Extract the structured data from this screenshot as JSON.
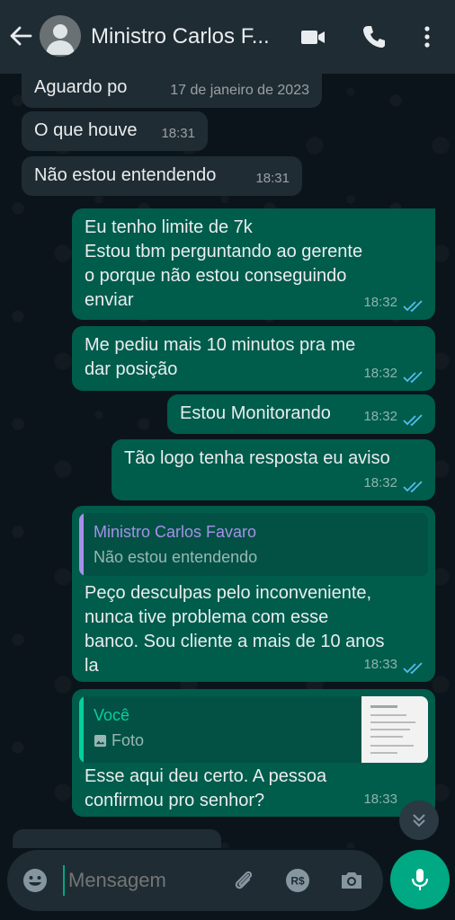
{
  "header": {
    "contact_name": "Ministro Carlos F...",
    "icons": [
      "back-arrow-icon",
      "avatar",
      "video-call-icon",
      "phone-icon",
      "more-options-icon"
    ]
  },
  "messages": [
    {
      "dir": "in",
      "text": "Aguardo po",
      "time": "17 de janeiro de 2023"
    },
    {
      "dir": "in",
      "text": "O que houve",
      "time": "18:31"
    },
    {
      "dir": "in",
      "text": "Não estou entendendo",
      "time": "18:31"
    },
    {
      "dir": "out",
      "text": "Eu tenho limite de 7k\nEstou tbm perguntando ao gerente\no porque não estou conseguindo\nenviar",
      "time": "18:32"
    },
    {
      "dir": "out",
      "text": "Me pediu mais 10 minutos pra me\ndar posição",
      "time": "18:32"
    },
    {
      "dir": "out",
      "text": "Estou Monitorando",
      "time": "18:32"
    },
    {
      "dir": "out",
      "text": "Tão logo tenha resposta eu aviso",
      "time": "18:32"
    },
    {
      "dir": "out",
      "quote_name": "Ministro Carlos Favaro",
      "quote_text": "Não estou entendendo",
      "text": "Peço desculpas pelo inconveniente,\nnunca tive problema com esse\nbanco. Sou cliente a mais de 10 anos\nla",
      "time": "18:33"
    },
    {
      "dir": "out",
      "quote_name": "Você",
      "quote_text": "Foto",
      "text": "Esse aqui deu certo. A pessoa\nconfirmou pro senhor?",
      "time": "18:33"
    }
  ],
  "input": {
    "placeholder": "Mensagem"
  },
  "colors": {
    "header_bg": "#1f2c34",
    "chat_bg": "#0b141a",
    "incoming_bubble": "#202c33",
    "outgoing_bubble": "#005c4b",
    "accent": "#00a884",
    "read_ticks": "#53bdeb",
    "quote_name_contact": "#a591e8",
    "quote_name_self": "#06cf9c"
  }
}
